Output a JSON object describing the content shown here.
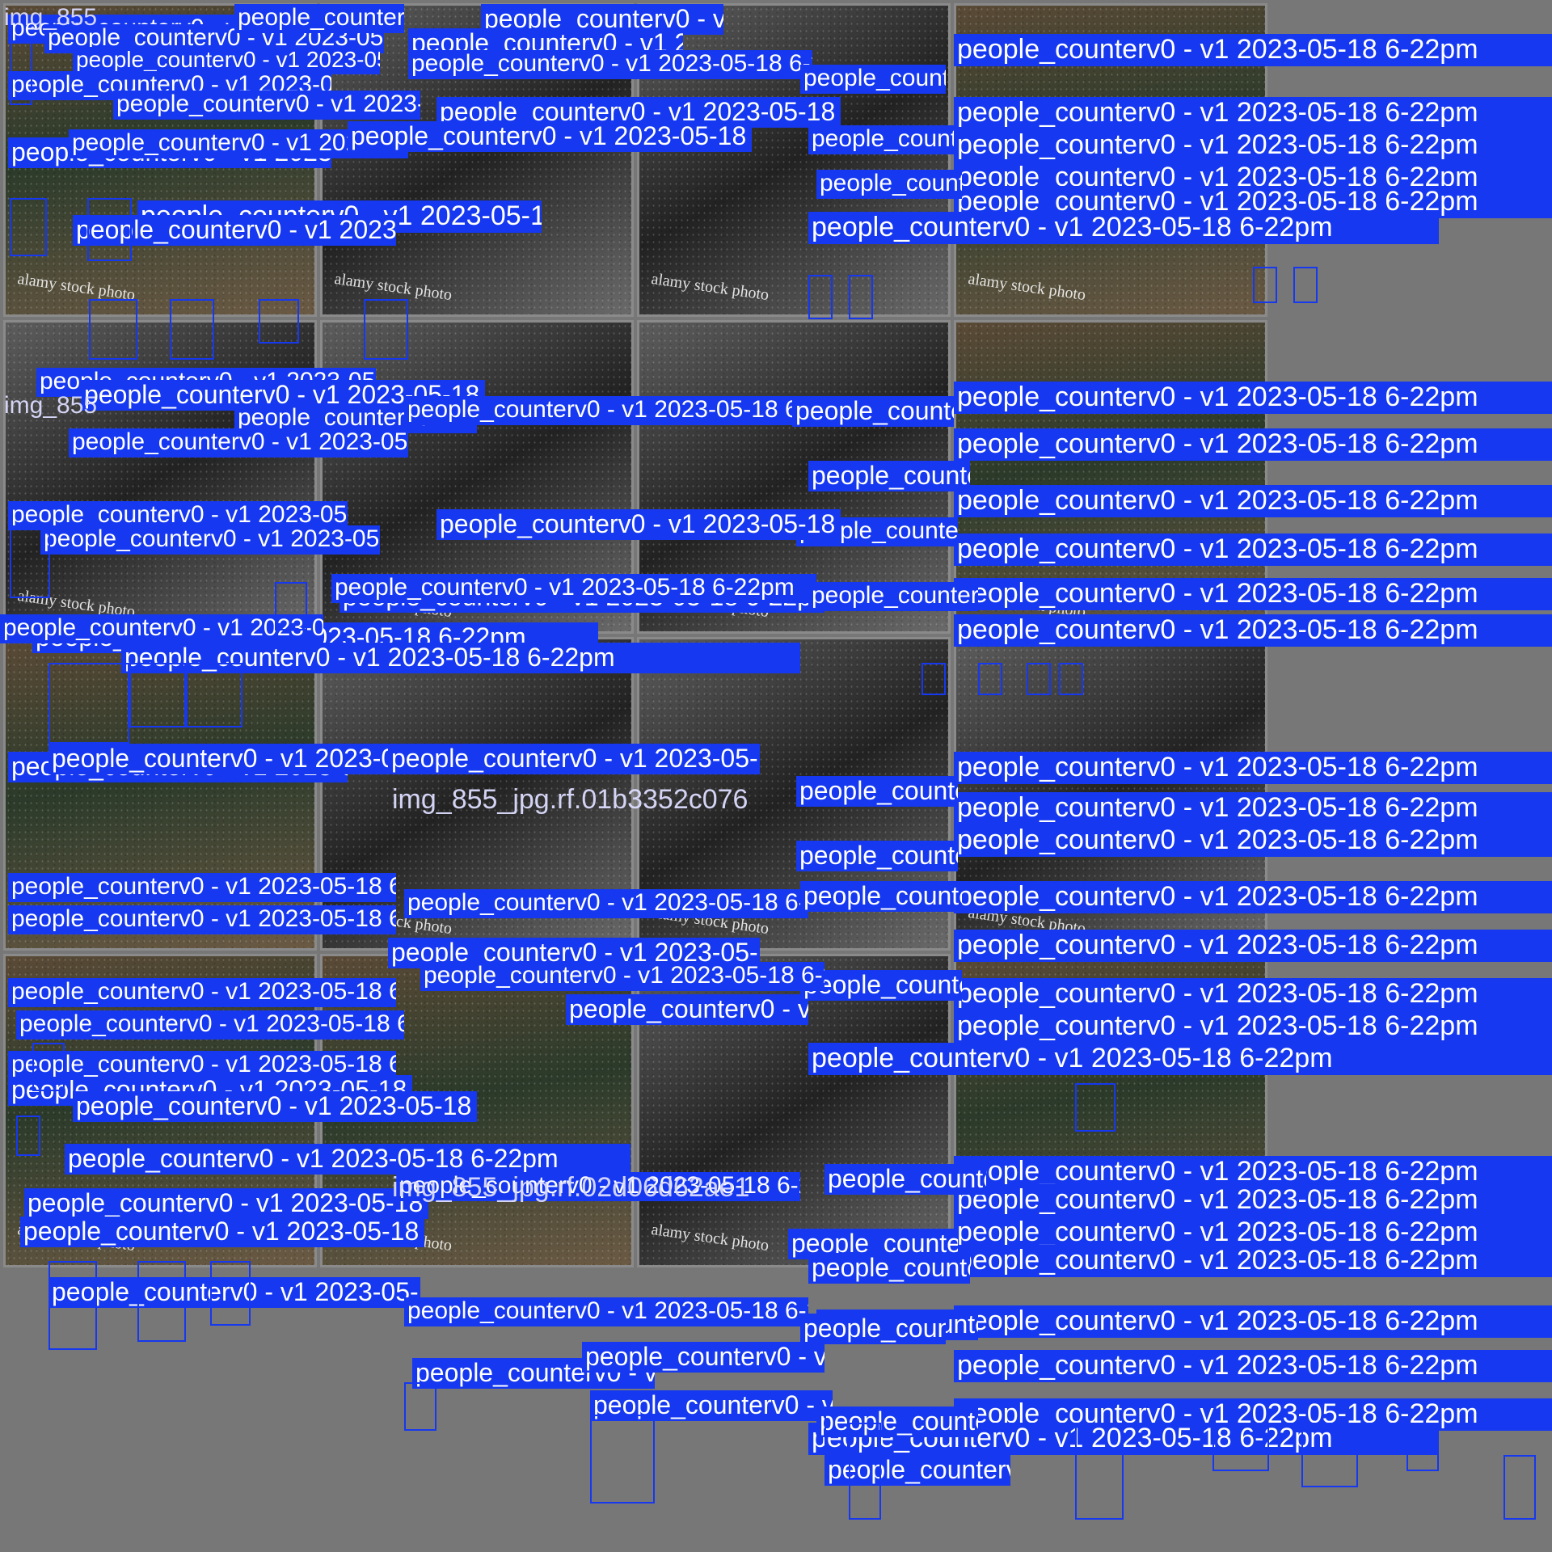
{
  "class_label": "people_counterv0 - v1 2023-05-18 6-22pm",
  "label_color": "#1538f0",
  "watermark": "alamy stock photo",
  "file_names": {
    "tile_0": "img_855",
    "tile_4": "img_855",
    "tile_9": "img_855_jpg.rf.01b3352c076",
    "tile_13": "img_855_jpg.rf.02d06d62ae1"
  },
  "tiles": [
    {
      "name": "tile-row1-col1",
      "style": "color"
    },
    {
      "name": "tile-row1-col2",
      "style": "bw"
    },
    {
      "name": "tile-row1-col3",
      "style": "bw"
    },
    {
      "name": "tile-row1-col4",
      "style": "color"
    },
    {
      "name": "tile-row2-col1",
      "style": "bw"
    },
    {
      "name": "tile-row2-col2",
      "style": "bw"
    },
    {
      "name": "tile-row2-col3",
      "style": "bw"
    },
    {
      "name": "tile-row2-col4",
      "style": "color"
    },
    {
      "name": "tile-row3-col1",
      "style": "color"
    },
    {
      "name": "tile-row3-col2",
      "style": "bw"
    },
    {
      "name": "tile-row3-col3",
      "style": "bw"
    },
    {
      "name": "tile-row3-col4",
      "style": "bw"
    },
    {
      "name": "tile-row4-col1",
      "style": "color"
    },
    {
      "name": "tile-row4-col2",
      "style": "color"
    },
    {
      "name": "tile-row4-col3",
      "style": "bw"
    },
    {
      "name": "tile-row4-col4",
      "style": "color"
    }
  ]
}
